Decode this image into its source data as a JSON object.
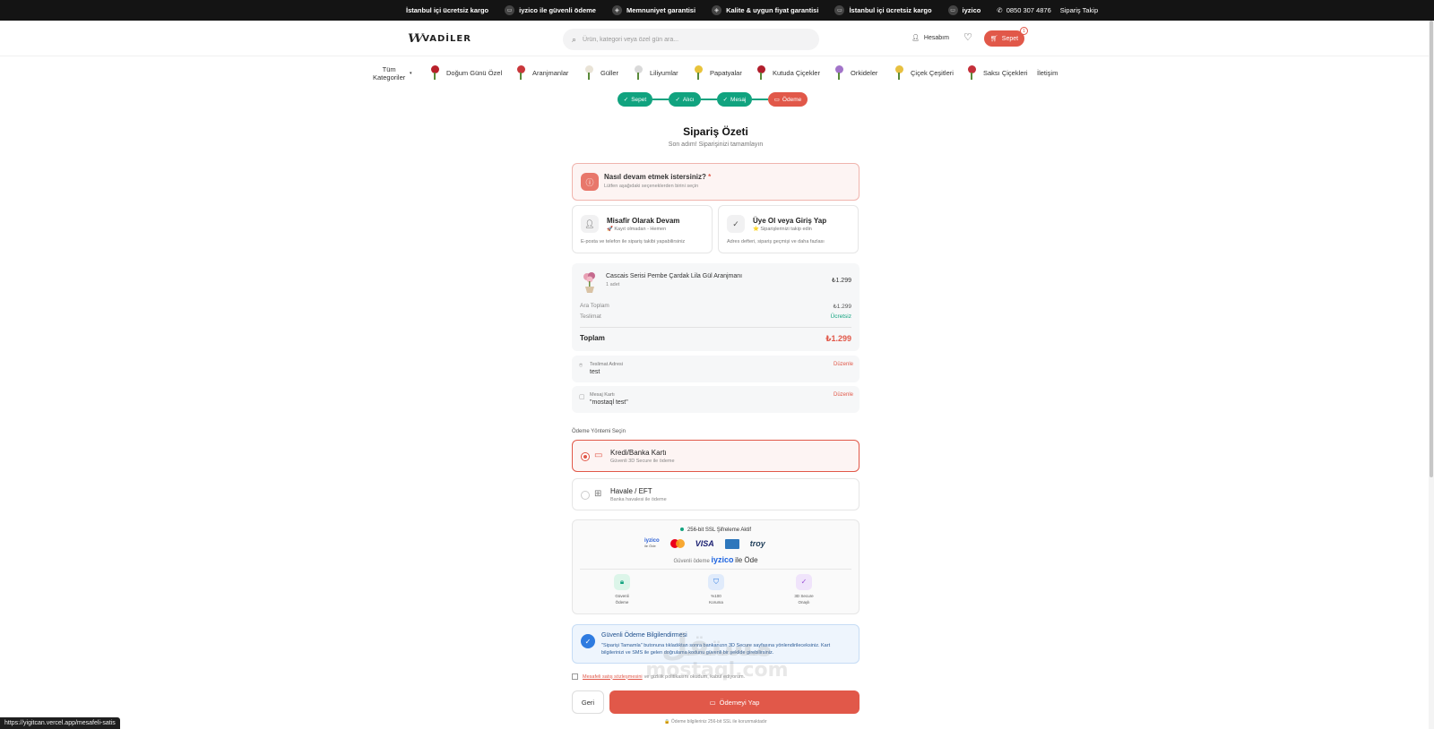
{
  "topbar": {
    "items": [
      {
        "icon": "truck-icon",
        "label": "İstanbul içi ücretsiz kargo"
      },
      {
        "icon": "card-icon",
        "label": "iyzico ile güvenli ödeme"
      },
      {
        "icon": "shield-icon",
        "label": "Memnuniyet garantisi"
      },
      {
        "icon": "badge-icon",
        "label": "Kalite & uygun fiyat garantisi"
      },
      {
        "icon": "truck-icon",
        "label": "İstanbul içi ücretsiz kargo"
      },
      {
        "icon": "card-icon",
        "label": "iyzico"
      }
    ],
    "phone": "0850 307 4876",
    "track_order": "Sipariş Takip"
  },
  "header": {
    "logo": "VADİLER",
    "search_placeholder": "Ürün, kategori veya özel gün ara...",
    "account_label": "Hesabım",
    "cart_label": "Sepet",
    "cart_count": "1"
  },
  "categories": {
    "all_label_line1": "Tüm",
    "all_label_line2": "Kategoriler",
    "items": [
      {
        "label": "Doğum Günü Özel",
        "color": "#b8202a"
      },
      {
        "label": "Aranjmanlar",
        "color": "#c9373b"
      },
      {
        "label": "Güller",
        "color": "#e9e3d6"
      },
      {
        "label": "Liliyumlar",
        "color": "#d9d9d9"
      },
      {
        "label": "Papatyalar",
        "color": "#e8c33a"
      },
      {
        "label": "Kutuda Çiçekler",
        "color": "#b11e2c"
      },
      {
        "label": "Orkideler",
        "color": "#a274c9"
      },
      {
        "label": "Çiçek Çeşitleri",
        "color": "#e7c040"
      },
      {
        "label": "Saksı Çiçekleri",
        "color": "#c4303a"
      }
    ],
    "contact": "İletişim"
  },
  "steps": [
    {
      "label": "Sepet",
      "state": "done"
    },
    {
      "label": "Alıcı",
      "state": "done"
    },
    {
      "label": "Mesaj",
      "state": "done"
    },
    {
      "label": "Ödeme",
      "state": "active"
    }
  ],
  "page": {
    "title": "Sipariş Özeti",
    "subtitle": "Son adım! Siparişinizi tamamlayın"
  },
  "checkout_choice": {
    "question": "Nasıl devam etmek istersiniz?",
    "required_mark": "*",
    "hint": "Lütfen aşağıdaki seçeneklerden birini seçin",
    "guest": {
      "title": "Misafir Olarak Devam",
      "subtitle": "🚀 Kayıt olmadan - Hemen",
      "desc": "E-posta ve telefon ile sipariş takibi yapabilirsiniz"
    },
    "member": {
      "title": "Üye Ol veya Giriş Yap",
      "subtitle": "⭐ Siparişlerinizi takip edin",
      "desc": "Adres defteri, sipariş geçmişi ve daha fazlası"
    }
  },
  "order": {
    "product_name": "Cascais Serisi Pembe Çardak Lila Gül Aranjmanı",
    "quantity": "1 adet",
    "price": "₺1.299",
    "subtotal_label": "Ara Toplam",
    "subtotal_value": "₺1.299",
    "delivery_label": "Teslimat",
    "delivery_value": "Ücretsiz",
    "total_label": "Toplam",
    "total_value": "₺1.299"
  },
  "delivery_address": {
    "label": "Teslimat Adresi",
    "value": "test",
    "edit": "Düzenle"
  },
  "message_card": {
    "label": "Mesaj Kartı",
    "value": "\"mostaql test\"",
    "edit": "Düzenle"
  },
  "payment": {
    "section_label": "Ödeme Yöntemi Seçin",
    "methods": [
      {
        "title": "Kredi/Banka Kartı",
        "subtitle": "Güvenli 3D Secure ile ödeme",
        "selected": true
      },
      {
        "title": "Havale / EFT",
        "subtitle": "Banka havalesi ile ödeme",
        "selected": false
      }
    ]
  },
  "security": {
    "ssl": "256-bit SSL Şifreleme Aktif",
    "logo_iyzico_small_1": "iyzico",
    "logo_iyzico_small_2": "ile Öde",
    "logo_visa": "VISA",
    "logo_troy": "troy",
    "guarantee_prefix": "Güvenli ödeme",
    "guarantee_brand": "iyzico",
    "guarantee_suffix": "ile Öde",
    "features": [
      {
        "line1": "Güvenli",
        "line2": "Ödeme",
        "icon": "lock-icon",
        "bg": "#dcf5e9",
        "fg": "#11a37f"
      },
      {
        "line1": "%100",
        "line2": "Koruma",
        "icon": "shield-icon",
        "bg": "#e0ebfb",
        "fg": "#2e7be0"
      },
      {
        "line1": "3D Secure",
        "line2": "Onaylı",
        "icon": "check-icon",
        "bg": "#f0e4fb",
        "fg": "#9a4fd6"
      }
    ]
  },
  "notice": {
    "title": "Güvenli Ödeme Bilgilendirmesi",
    "text": "\"Siparişi Tamamla\" butonuna tıkladıktan sonra bankanızın 3D Secure sayfasına yönlendirileceksiniz. Kart bilgilerinizi ve SMS ile gelen doğrulama kodunu güvenli bir şekilde girebilirsiniz."
  },
  "agreement": {
    "link_text": "Mesafeli satış sözleşmesini",
    "rest_text": "ve gizlilik politikasını okudum, kabul ediyorum."
  },
  "actions": {
    "back": "Geri",
    "pay": "Ödemeyi Yap",
    "footnote": "🔒 Ödeme bilgileriniz 256-bit SSL ile korunmaktadır"
  },
  "status_url": "https://yigitcan.vercel.app/mesafeli-satis",
  "watermark": {
    "arabic": "مستقل",
    "latin": "mostaql.com"
  }
}
